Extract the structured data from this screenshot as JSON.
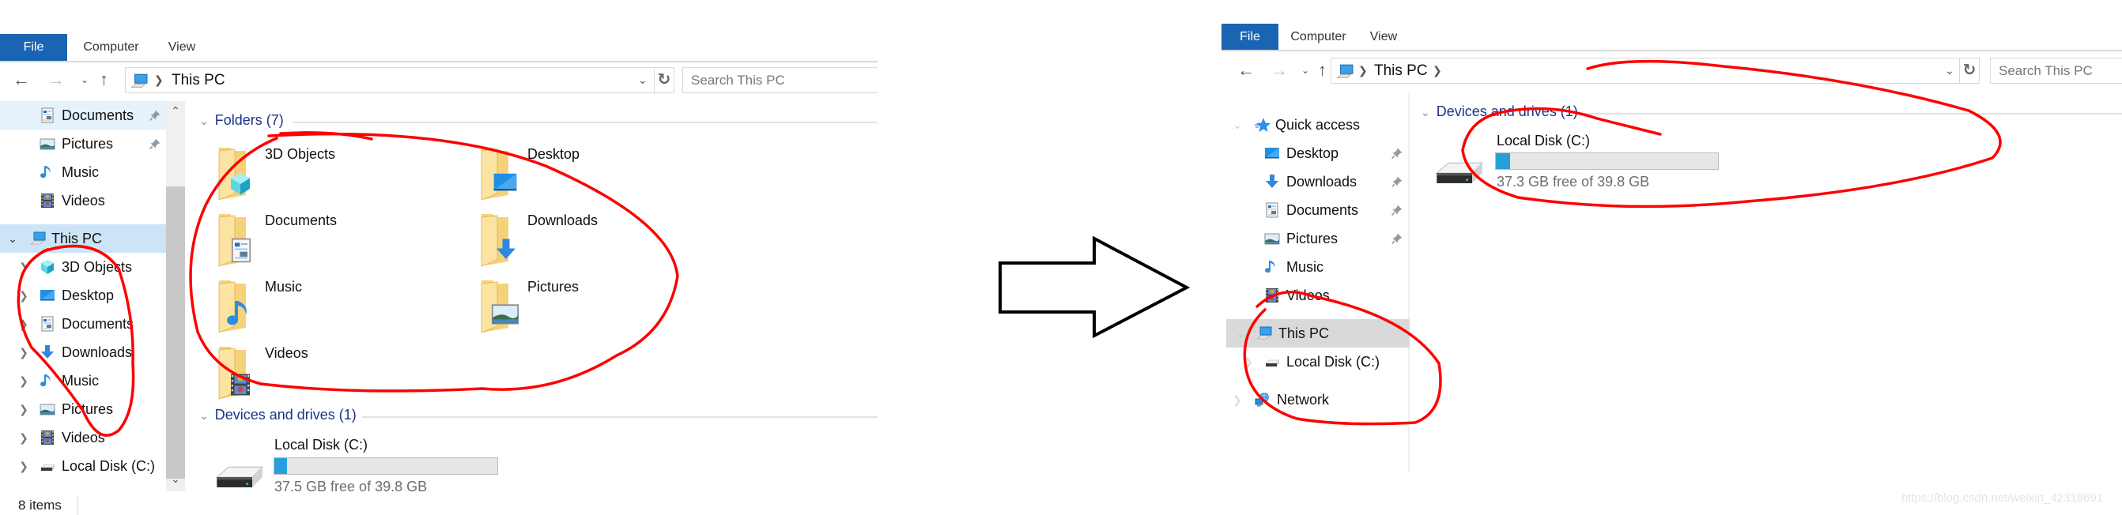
{
  "before": {
    "ribbon_tabs": [
      "File",
      "Computer",
      "View"
    ],
    "address": {
      "crumbs": [
        "This PC"
      ]
    },
    "search_placeholder": "Search This PC",
    "nav_tree": {
      "quick_access_items": [
        {
          "label": "Documents",
          "icon": "documents-icon",
          "pinned": true
        },
        {
          "label": "Pictures",
          "icon": "pictures-icon",
          "pinned": true
        },
        {
          "label": "Music",
          "icon": "music-icon",
          "pinned": false
        },
        {
          "label": "Videos",
          "icon": "videos-icon",
          "pinned": false
        }
      ],
      "this_pc": {
        "label": "This PC",
        "icon": "computer-icon",
        "expanded": true
      },
      "this_pc_children": [
        {
          "label": "3D Objects",
          "icon": "3d-objects-icon"
        },
        {
          "label": "Desktop",
          "icon": "desktop-icon"
        },
        {
          "label": "Documents",
          "icon": "documents-icon"
        },
        {
          "label": "Downloads",
          "icon": "downloads-icon"
        },
        {
          "label": "Music",
          "icon": "music-icon"
        },
        {
          "label": "Pictures",
          "icon": "pictures-icon"
        },
        {
          "label": "Videos",
          "icon": "videos-icon"
        },
        {
          "label": "Local Disk (C:)",
          "icon": "drive-icon"
        }
      ]
    },
    "folders_group": {
      "title": "Folders (7)",
      "items": [
        {
          "label": "3D Objects",
          "overlay": "3d-objects-icon"
        },
        {
          "label": "Desktop",
          "overlay": "desktop-icon"
        },
        {
          "label": "Documents",
          "overlay": "documents-icon"
        },
        {
          "label": "Downloads",
          "overlay": "downloads-icon"
        },
        {
          "label": "Music",
          "overlay": "music-icon"
        },
        {
          "label": "Pictures",
          "overlay": "pictures-icon"
        },
        {
          "label": "Videos",
          "overlay": "videos-icon"
        }
      ]
    },
    "devices_group": {
      "title": "Devices and drives (1)",
      "drives": [
        {
          "label": "Local Disk (C:)",
          "free_text": "37.5 GB free of 39.8 GB",
          "used_fraction": 0.058
        }
      ]
    },
    "status_bar": "8 items"
  },
  "after": {
    "ribbon_tabs": [
      "File",
      "Computer",
      "View"
    ],
    "address": {
      "crumbs": [
        "This PC"
      ]
    },
    "search_placeholder": "Search This PC",
    "nav_tree": {
      "quick_access": {
        "label": "Quick access",
        "icon": "quick-access-star-icon"
      },
      "quick_access_items": [
        {
          "label": "Desktop",
          "icon": "desktop-icon",
          "pinned": true
        },
        {
          "label": "Downloads",
          "icon": "downloads-icon",
          "pinned": true
        },
        {
          "label": "Documents",
          "icon": "documents-icon",
          "pinned": true
        },
        {
          "label": "Pictures",
          "icon": "pictures-icon",
          "pinned": true
        },
        {
          "label": "Music",
          "icon": "music-icon",
          "pinned": false
        },
        {
          "label": "Videos",
          "icon": "videos-icon",
          "pinned": false
        }
      ],
      "this_pc": {
        "label": "This PC",
        "icon": "computer-icon",
        "selected": true
      },
      "this_pc_children": [
        {
          "label": "Local Disk (C:)",
          "icon": "drive-icon"
        }
      ],
      "network": {
        "label": "Network",
        "icon": "network-icon"
      }
    },
    "devices_group": {
      "title": "Devices and drives (1)",
      "drives": [
        {
          "label": "Local Disk (C:)",
          "free_text": "37.3 GB free of 39.8 GB",
          "used_fraction": 0.063
        }
      ]
    }
  },
  "watermark": "https://blog.csdn.net/weixin_42318691",
  "colors": {
    "file_tab": "#1a65b3",
    "group_header": "#1e3287",
    "drive_fill": "#26a0da",
    "annotation": "#ff0000",
    "nav_selected": "#cce4f7",
    "nav_selected_gray": "#d9d9d9"
  }
}
